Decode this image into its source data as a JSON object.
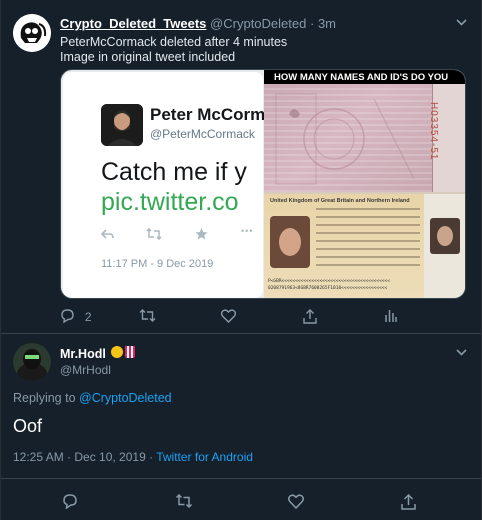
{
  "tweet1": {
    "display_name": "Crypto_Deleted_Tweets",
    "handle": "@CryptoDeleted",
    "separator": "·",
    "time": "3m",
    "line1": "PeterMcCormack deleted after 4 minutes",
    "line2": "Image in original tweet included",
    "card": {
      "name": "Peter McCorm",
      "handle": "@PeterMcCormack",
      "text_line1": "Catch me if y",
      "text_line2": "pic.twitter.co",
      "date": "11:17 PM - 9 Dec 2019",
      "more": "•••"
    },
    "photo": {
      "banner": "HOW MANY NAMES AND ID'S DO YOU",
      "passport_title": "United Kingdom of Great Britain and Northern Ireland",
      "serial": "H03354-51",
      "mrz1": "P<GBR<<<<<<<<<<<<<<<<<<<<<<<<<<<<<<<<<<<<<<<<",
      "mrz2": "0208791963<8GBR7608265F1010<<<<<<<<<<<<<<<<<"
    },
    "actions": {
      "replies": "2"
    }
  },
  "tweet2": {
    "display_name": "Mr.Hodl",
    "handle": "@MrHodl",
    "replying_prefix": "Replying to ",
    "replying_to": "@CryptoDeleted",
    "text": "Oof",
    "timestamp": "12:25 AM · Dec 10, 2019 · ",
    "source": "Twitter for Android"
  },
  "icons": {
    "reply": "reply-icon",
    "retweet": "retweet-icon",
    "like": "heart-icon",
    "share": "share-icon",
    "analytics": "analytics-icon",
    "chevron": "chevron-down-icon"
  },
  "colors": {
    "background": "#15202b",
    "border": "#38444d",
    "accent": "#1da1f2",
    "muted": "#8899a6"
  }
}
